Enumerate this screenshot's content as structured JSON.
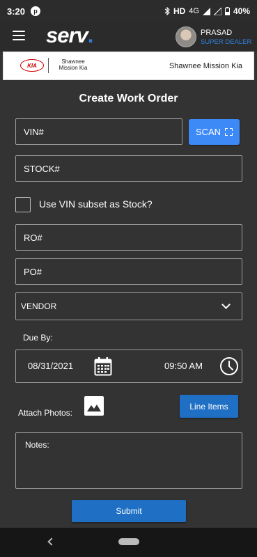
{
  "status_bar": {
    "time": "3:20",
    "notification_icon": "p",
    "network": "HD",
    "signal": "4G",
    "battery": "40%"
  },
  "app_bar": {
    "logo_text": "serv",
    "logo_dot": ".",
    "user_name": "PRASAD",
    "user_role": "SUPER DEALER"
  },
  "dealer": {
    "brand_logo": "KIA",
    "logo_name": "Shawnee Mission Kia",
    "name": "Shawnee Mission Kia"
  },
  "form": {
    "title": "Create Work Order",
    "vin_placeholder": "VIN#",
    "scan_label": "SCAN",
    "stock_placeholder": "STOCK#",
    "vin_subset_label": "Use VIN subset as Stock?",
    "ro_placeholder": "RO#",
    "po_placeholder": "PO#",
    "vendor_selected": "VENDOR",
    "due_by_label": "Due By:",
    "due_date": "08/31/2021",
    "due_time": "09:50 AM",
    "attach_photos_label": "Attach Photos:",
    "line_items_label": "Line Items",
    "notes_label": "Notes:",
    "submit_label": "Submit"
  },
  "colors": {
    "background": "#333333",
    "accent_blue": "#3d8af7",
    "button_blue": "#1f6fc5",
    "role_blue": "#2f7fd8"
  }
}
